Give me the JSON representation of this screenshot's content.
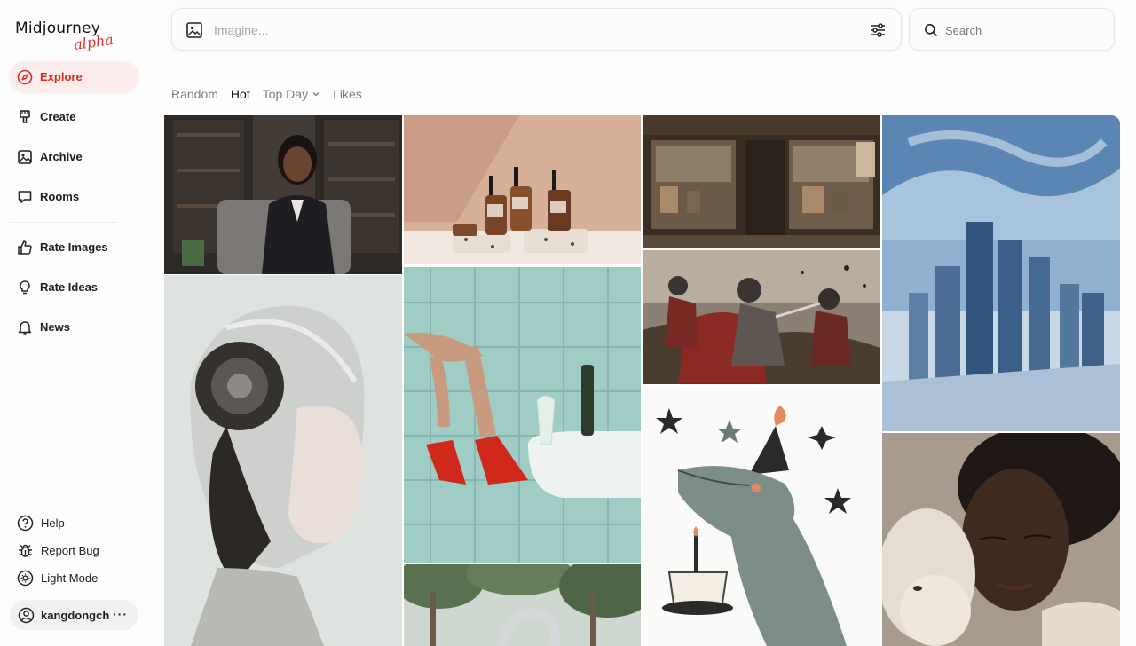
{
  "app": {
    "logo": "Midjourney",
    "logo_badge": "alpha"
  },
  "sidebar": {
    "items": [
      {
        "label": "Explore",
        "icon": "compass-icon",
        "active": true
      },
      {
        "label": "Create",
        "icon": "brush-icon"
      },
      {
        "label": "Archive",
        "icon": "image-icon"
      },
      {
        "label": "Rooms",
        "icon": "chat-icon"
      },
      {
        "label": "Rate Images",
        "icon": "thumbs-up-icon"
      },
      {
        "label": "Rate Ideas",
        "icon": "lightbulb-icon"
      },
      {
        "label": "News",
        "icon": "bell-icon"
      }
    ],
    "bottom": [
      {
        "label": "Help",
        "icon": "help-icon"
      },
      {
        "label": "Report Bug",
        "icon": "bug-icon"
      },
      {
        "label": "Light Mode",
        "icon": "sun-icon"
      }
    ],
    "user": {
      "name": "kangdongch",
      "more": "···"
    }
  },
  "topbar": {
    "imagine_placeholder": "Imagine...",
    "search_placeholder": "Search"
  },
  "tabs": [
    {
      "label": "Random",
      "active": false
    },
    {
      "label": "Hot",
      "active": true
    },
    {
      "label": "Top Day",
      "active": false,
      "dropdown": true
    },
    {
      "label": "Likes",
      "active": false
    }
  ],
  "colors": {
    "accent": "#d72d2a",
    "active_bg": "#fdecec"
  }
}
